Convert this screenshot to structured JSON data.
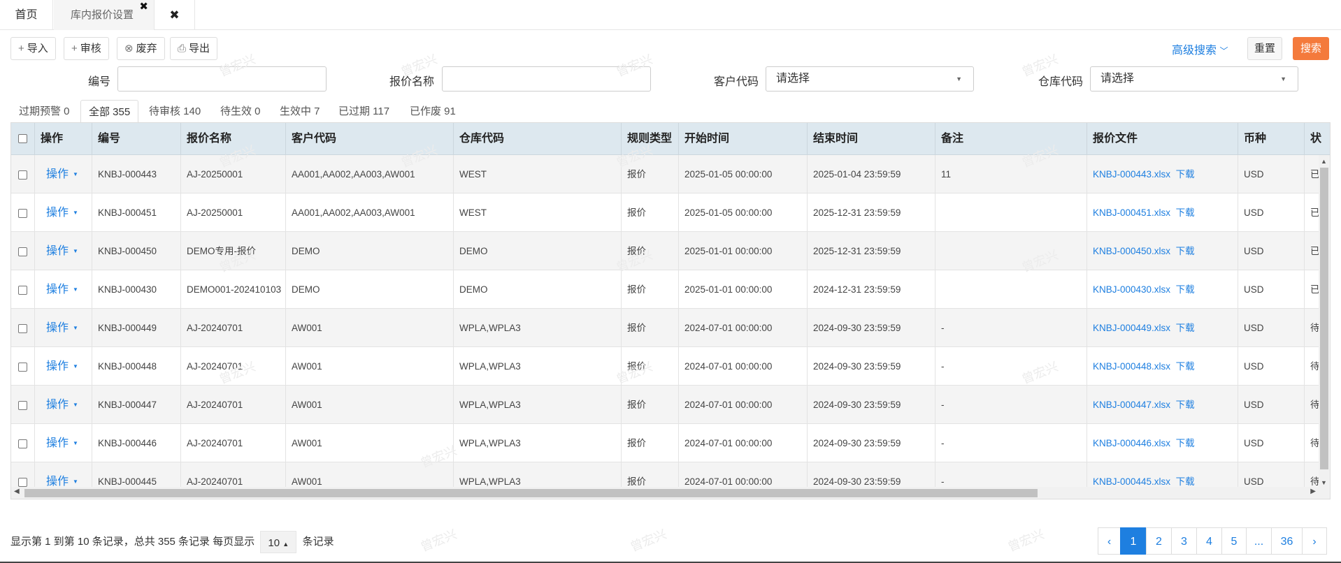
{
  "tabs": {
    "home": "首页",
    "active": "库内报价设置",
    "active_close": "✖",
    "close_all": "✖"
  },
  "toolbar": {
    "import": {
      "icon": "+",
      "label": "导入"
    },
    "audit": {
      "icon": "+",
      "label": "审核"
    },
    "discard": {
      "icon": "⊗",
      "label": "废弃"
    },
    "export": {
      "icon": "⎙",
      "label": "导出"
    },
    "advanced": "高级搜索",
    "reset": "重置",
    "search": "搜索"
  },
  "filters": {
    "code_label": "编号",
    "code_value": "",
    "name_label": "报价名称",
    "name_value": "",
    "customer_label": "客户代码",
    "customer_value": "请选择",
    "warehouse_label": "仓库代码",
    "warehouse_value": "请选择"
  },
  "status_tabs": [
    "过期预警 0",
    "全部 355",
    "待审核 140",
    "待生效 0",
    "生效中 7",
    "已过期 117",
    "已作废 91"
  ],
  "table": {
    "headers": [
      "操作",
      "编号",
      "报价名称",
      "客户代码",
      "仓库代码",
      "规则类型",
      "开始时间",
      "结束时间",
      "备注",
      "报价文件",
      "币种",
      "状"
    ],
    "op_label": "操作",
    "download_label": "下载",
    "rows": [
      [
        "KNBJ-000443",
        "AJ-20250001",
        "AA001,AA002,AA003,AW001",
        "WEST",
        "报价",
        "2025-01-05 00:00:00",
        "2025-01-04 23:59:59",
        "11",
        "KNBJ-000443.xlsx",
        "USD",
        "已"
      ],
      [
        "KNBJ-000451",
        "AJ-20250001",
        "AA001,AA002,AA003,AW001",
        "WEST",
        "报价",
        "2025-01-05 00:00:00",
        "2025-12-31 23:59:59",
        "",
        "KNBJ-000451.xlsx",
        "USD",
        "已"
      ],
      [
        "KNBJ-000450",
        "DEMO专用-报价",
        "DEMO",
        "DEMO",
        "报价",
        "2025-01-01 00:00:00",
        "2025-12-31 23:59:59",
        "",
        "KNBJ-000450.xlsx",
        "USD",
        "已"
      ],
      [
        "KNBJ-000430",
        "DEMO001-202410103",
        "DEMO",
        "DEMO",
        "报价",
        "2025-01-01 00:00:00",
        "2024-12-31 23:59:59",
        "",
        "KNBJ-000430.xlsx",
        "USD",
        "已"
      ],
      [
        "KNBJ-000449",
        "AJ-20240701",
        "AW001",
        "WPLA,WPLA3",
        "报价",
        "2024-07-01 00:00:00",
        "2024-09-30 23:59:59",
        "-",
        "KNBJ-000449.xlsx",
        "USD",
        "待"
      ],
      [
        "KNBJ-000448",
        "AJ-20240701",
        "AW001",
        "WPLA,WPLA3",
        "报价",
        "2024-07-01 00:00:00",
        "2024-09-30 23:59:59",
        "-",
        "KNBJ-000448.xlsx",
        "USD",
        "待"
      ],
      [
        "KNBJ-000447",
        "AJ-20240701",
        "AW001",
        "WPLA,WPLA3",
        "报价",
        "2024-07-01 00:00:00",
        "2024-09-30 23:59:59",
        "-",
        "KNBJ-000447.xlsx",
        "USD",
        "待"
      ],
      [
        "KNBJ-000446",
        "AJ-20240701",
        "AW001",
        "WPLA,WPLA3",
        "报价",
        "2024-07-01 00:00:00",
        "2024-09-30 23:59:59",
        "-",
        "KNBJ-000446.xlsx",
        "USD",
        "待"
      ],
      [
        "KNBJ-000445",
        "AJ-20240701",
        "AW001",
        "WPLA,WPLA3",
        "报价",
        "2024-07-01 00:00:00",
        "2024-09-30 23:59:59",
        "-",
        "KNBJ-000445.xlsx",
        "USD",
        "待"
      ]
    ]
  },
  "footer": {
    "prefix": "显示第 1 到第 10 条记录，总共 355 条记录  每页显示",
    "page_size": "10",
    "suffix": "条记录"
  },
  "pagination": [
    "‹",
    "1",
    "2",
    "3",
    "4",
    "5",
    "...",
    "36",
    "›"
  ],
  "watermark": "曾宏兴",
  "colors": {
    "accent": "#1e7fe0",
    "search": "#f47a3c",
    "header_bg": "#dde8ef"
  }
}
